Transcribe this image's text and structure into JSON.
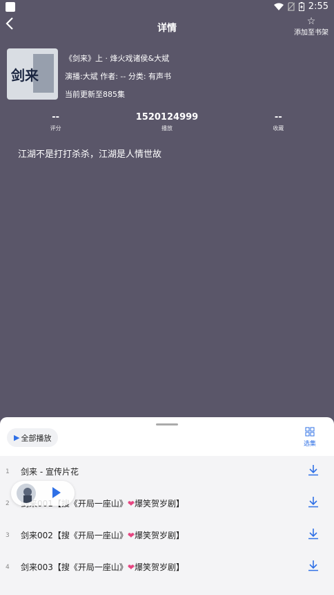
{
  "status": {
    "time": "2:55"
  },
  "header": {
    "title": "详情",
    "favorite_label": "添加至书架"
  },
  "book": {
    "title": "《剑来》上 · 烽火戏诸侯&大斌",
    "cast": "演播:大斌  作者: -- 分类: 有声书",
    "update": "当前更新至885集",
    "cover_text": "剑来"
  },
  "stats": [
    {
      "value": "--",
      "label": "评分"
    },
    {
      "value": "1520124999",
      "label": "播放"
    },
    {
      "value": "--",
      "label": "收藏"
    }
  ],
  "description": "江湖不是打打杀杀，江湖是人情世故",
  "sheet": {
    "play_all": "全部播放",
    "select_label": "选集"
  },
  "episodes": [
    {
      "num": "1",
      "title": "剑来 - 宣传片花",
      "suffix": ""
    },
    {
      "num": "2",
      "title": "剑来001【搜《开局一座山》",
      "suffix": "爆笑贺岁剧】"
    },
    {
      "num": "3",
      "title": "剑来002【搜《开局一座山》",
      "suffix": "爆笑贺岁剧】"
    },
    {
      "num": "4",
      "title": "剑来003【搜《开局一座山》",
      "suffix": "爆笑贺岁剧】"
    }
  ],
  "colors": {
    "accent": "#2f70e6",
    "background": "#5a5669",
    "heart": "#e64580"
  }
}
